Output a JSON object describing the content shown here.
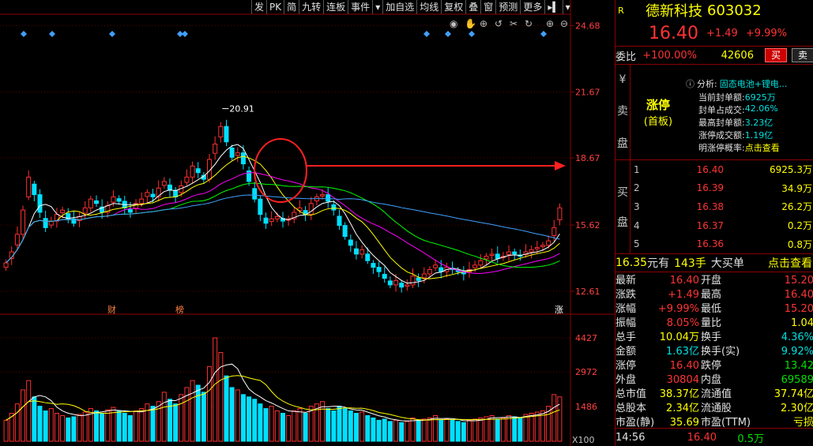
{
  "toolbar": [
    "发",
    "PK",
    "简",
    "九转",
    "连板",
    "事件",
    "▾",
    "加自选",
    "均线",
    "复权",
    "叠",
    "窗",
    "预测",
    "更多",
    "▸▍",
    "▾"
  ],
  "axis": {
    "price_ticks": [
      "24.68",
      "21.67",
      "18.67",
      "15.62",
      "12.61"
    ],
    "volume_ticks": [
      "4427",
      "2972",
      "1486"
    ],
    "volume_unit": "X100",
    "peak_label": "20.91",
    "markers": [
      "财",
      "榜",
      "涨"
    ]
  },
  "quote": {
    "flag": "R",
    "name": "德新科技",
    "code": "603032",
    "price": "16.40",
    "change": "+1.49",
    "change_pct": "+9.99%",
    "webi_label": "委比",
    "webi_value": "+100.00%",
    "webi_volume": "42606",
    "buy_btn": "买",
    "sell_btn": "卖"
  },
  "ask_panel": {
    "side_label": [
      "¥",
      "卖",
      "盘"
    ],
    "status": "涨停",
    "sub_status": "(首板)",
    "analysis_label": "分析:",
    "analysis_text": "固态电池+锂电...",
    "items": [
      {
        "k": "当前封单额:",
        "v": "6925万"
      },
      {
        "k": "封单占成交:",
        "v": "42.06%"
      },
      {
        "k": "最高封单额:",
        "v": "3.23亿"
      },
      {
        "k": "涨停成交额:",
        "v": "1.19亿"
      },
      {
        "k": "明涨停概率:",
        "v": "点击查看"
      }
    ]
  },
  "bid_panel": {
    "side_label": [
      "买",
      "盘"
    ],
    "rows": [
      {
        "n": "1",
        "p": "16.40",
        "v": "6925.3万"
      },
      {
        "n": "2",
        "p": "16.39",
        "v": "34.9万"
      },
      {
        "n": "3",
        "p": "16.38",
        "v": "26.2万"
      },
      {
        "n": "4",
        "p": "16.37",
        "v": "0.2万"
      },
      {
        "n": "5",
        "p": "16.36",
        "v": "0.8万"
      }
    ]
  },
  "band": {
    "price": "16.35",
    "unit": "元有",
    "lots": "143手",
    "big": "大买单",
    "link": "点击查看"
  },
  "stats": [
    [
      "最新",
      "16.40",
      "开盘",
      "15.20"
    ],
    [
      "涨跌",
      "+1.49",
      "最高",
      "16.40"
    ],
    [
      "涨幅",
      "+9.99%",
      "最低",
      "15.20"
    ],
    [
      "振幅",
      "8.05%",
      "量比",
      "1.04"
    ],
    [
      "总手",
      "10.04万",
      "换手",
      "4.36%"
    ],
    [
      "金额",
      "1.63亿",
      "换手(实)",
      "9.92%"
    ],
    [
      "涨停",
      "16.40",
      "跌停",
      "13.42"
    ],
    [
      "外盘",
      "30804",
      "内盘",
      "69589"
    ],
    [
      "总市值",
      "38.37亿",
      "流通值",
      "37.74亿"
    ],
    [
      "总股本",
      "2.34亿",
      "流通股",
      "2.30亿"
    ],
    [
      "市盈(静)",
      "35.69",
      "市盈(TTM)",
      "亏损"
    ]
  ],
  "tick": {
    "time": "14:56",
    "price": "16.40",
    "vol": "0.5万"
  }
}
